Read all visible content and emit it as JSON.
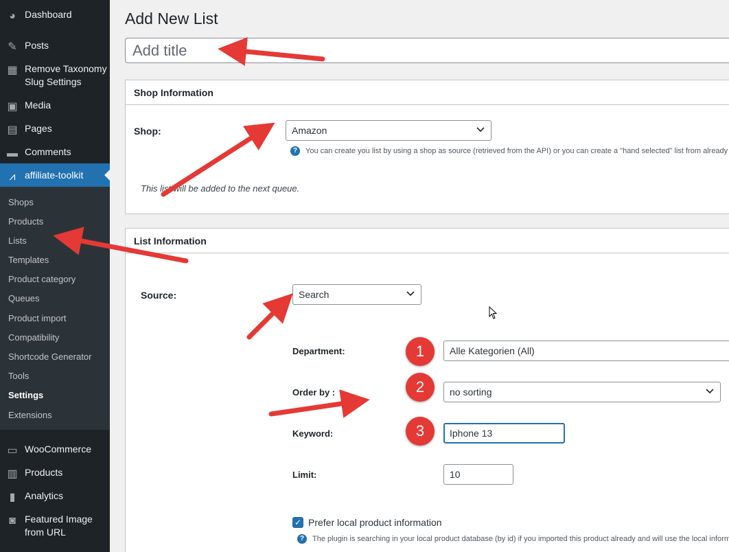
{
  "sidebar": {
    "top_items": [
      {
        "label": "Dashboard",
        "icon": "dashboard-icon"
      },
      {
        "label": "Posts",
        "icon": "pin-icon"
      },
      {
        "label": "Remove Taxonomy Slug Settings",
        "icon": "taxonomy-icon"
      },
      {
        "label": "Media",
        "icon": "media-icon"
      },
      {
        "label": "Pages",
        "icon": "pages-icon"
      },
      {
        "label": "Comments",
        "icon": "comments-icon"
      }
    ],
    "active_item": {
      "label": "affiliate-toolkit",
      "icon": "affiliate-toolkit-icon"
    },
    "submenu": [
      "Shops",
      "Products",
      "Lists",
      "Templates",
      "Product category",
      "Queues",
      "Product import",
      "Compatibility",
      "Shortcode Generator",
      "Tools",
      "Settings",
      "Extensions"
    ],
    "bottom_items": [
      {
        "label": "WooCommerce",
        "icon": "woocommerce-icon"
      },
      {
        "label": "Products",
        "icon": "products-icon"
      },
      {
        "label": "Analytics",
        "icon": "analytics-icon"
      },
      {
        "label": "Featured Image from URL",
        "icon": "camera-icon"
      }
    ]
  },
  "page": {
    "title": "Add New List",
    "title_placeholder": "Add title"
  },
  "shop_box": {
    "header": "Shop Information",
    "shop_label": "Shop:",
    "shop_value": "Amazon",
    "help": "You can create you list by using a shop as source (retrieved from the API) or you can create a \"hand selected\" list from already in",
    "note": "This list will be added to the next queue."
  },
  "list_box": {
    "header": "List Information",
    "source_label": "Source:",
    "source_value": "Search",
    "department_label": "Department:",
    "department_value": "Alle Kategorien (All)",
    "orderby_label": "Order by :",
    "orderby_value": "no sorting",
    "keyword_label": "Keyword:",
    "keyword_value": "Iphone 13",
    "limit_label": "Limit:",
    "limit_value": "10",
    "prefer_label": "Prefer local product information",
    "prefer_help": "The plugin is searching in your local product database (by id) if you imported this product already and will use the local inform"
  },
  "badges": [
    "1",
    "2",
    "3"
  ],
  "colors": {
    "sidebar": "#1d2327",
    "accent": "#2271b1",
    "annotation": "#e53935"
  }
}
